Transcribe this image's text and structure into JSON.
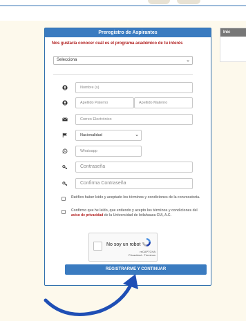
{
  "form": {
    "title": "Preregistro de Aspirantes",
    "program_question": "Nos gustaría conocer cuál es el programa académico de tu interés",
    "program_select_value": "Selecciona",
    "fields": {
      "nombre": "Nombre (s)",
      "apellido_paterno": "Apellido Paterno",
      "apellido_materno": "Apellido Materno",
      "correo": "Correo Electrónico",
      "nacionalidad": "Nacionalidad",
      "whatsapp": "Whatsapp",
      "contrasena": "Contraseña",
      "confirmar": "Confirma Contraseña"
    },
    "ratify_text": "Ratifico haber leído y aceptado los términos y condiciones de la convocatoria.",
    "privacy_text_before": "Confirmo que he leído, que entiendo y acepto los términos y condiciones del ",
    "privacy_link": "aviso de privacidad",
    "privacy_text_after": " de la Universidad de Ixtlahuaca CUI, A.C.",
    "recaptcha_label": "No soy un robot",
    "recaptcha_brand": "reCAPTCHA",
    "recaptcha_terms": "Privacidad - Términos",
    "submit_label": "REGISTRARME Y CONTINUAR"
  },
  "side": {
    "header": "Inic"
  },
  "colors": {
    "primary": "#3a7bc0",
    "accent_red": "#b01c1c",
    "arrow": "#1f4fb5"
  }
}
